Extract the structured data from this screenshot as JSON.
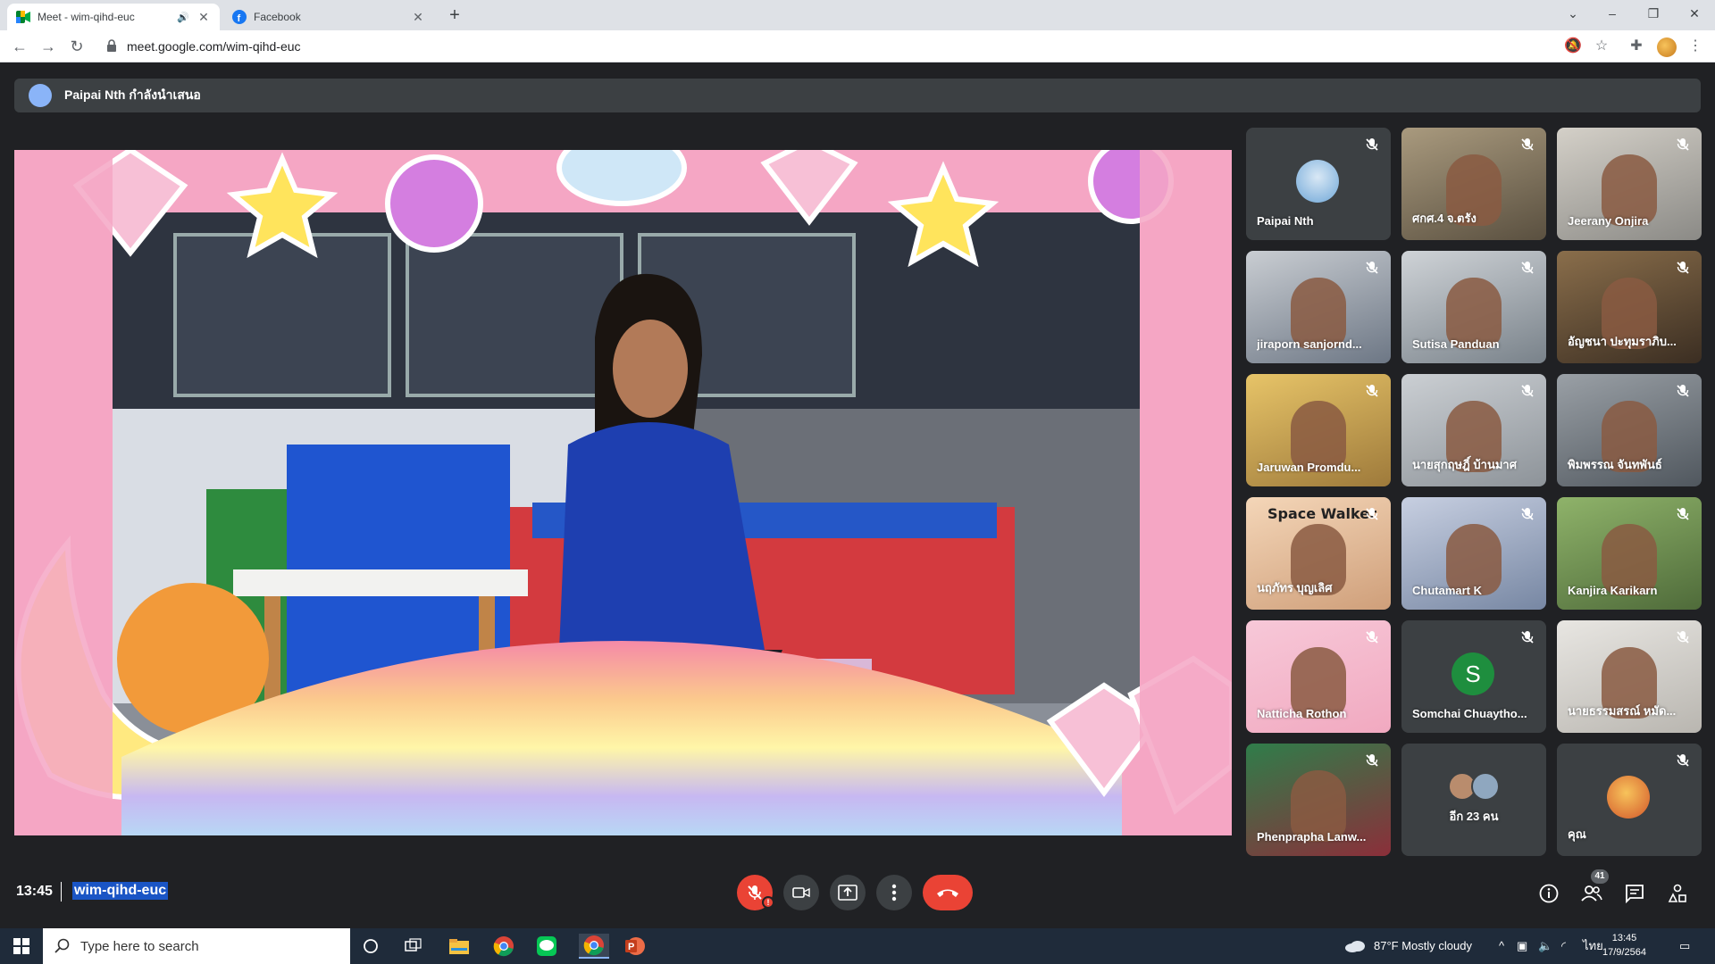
{
  "browser": {
    "tabs": [
      {
        "title": "Meet - wim-qihd-euc",
        "active": true
      },
      {
        "title": "Facebook",
        "active": false
      }
    ],
    "url": "meet.google.com/wim-qihd-euc"
  },
  "meet": {
    "presenting_banner": "Paipai Nth กำลังนำเสนอ",
    "participants": [
      {
        "name": "Paipai Nth",
        "kind": "avatar"
      },
      {
        "name": "ศกศ.4 จ.ตรัง",
        "kind": "video"
      },
      {
        "name": "Jeerany Onjira",
        "kind": "video"
      },
      {
        "name": "jiraporn sanjornd...",
        "kind": "video"
      },
      {
        "name": "Sutisa Panduan",
        "kind": "video"
      },
      {
        "name": "อัญชนา ปะทุมราภิบ...",
        "kind": "video"
      },
      {
        "name": "Jaruwan Promdu...",
        "kind": "video"
      },
      {
        "name": "นายสุกฤษฎิ์ บ้านมาศ",
        "kind": "video"
      },
      {
        "name": "พิมพรรณ จันทพันธ์",
        "kind": "video"
      },
      {
        "name": "นฤภัทร บุญเลิศ",
        "kind": "video",
        "overlay": "Space Walker"
      },
      {
        "name": "Chutamart K",
        "kind": "video"
      },
      {
        "name": "Kanjira Karikarn",
        "kind": "video"
      },
      {
        "name": "Natticha Rothon",
        "kind": "video"
      },
      {
        "name": "Somchai Chuaytho...",
        "kind": "letter",
        "letter": "S"
      },
      {
        "name": "นายธรรมสรณ์ หมัด...",
        "kind": "video"
      },
      {
        "name": "Phenprapha Lanw...",
        "kind": "video"
      },
      {
        "name": "อีก 23 คน",
        "kind": "more"
      },
      {
        "name": "คุณ",
        "kind": "avatar"
      }
    ],
    "time": "13:45",
    "meeting_code": "wim-qihd-euc",
    "people_count": "41"
  },
  "taskbar": {
    "search_placeholder": "Type here to search",
    "weather": "87°F  Mostly cloudy",
    "lang": "ไทย",
    "time": "13:45",
    "date": "17/9/2564"
  },
  "colors": {
    "end_call": "#ea4335",
    "letter_avatar": "#1e8e3e"
  }
}
